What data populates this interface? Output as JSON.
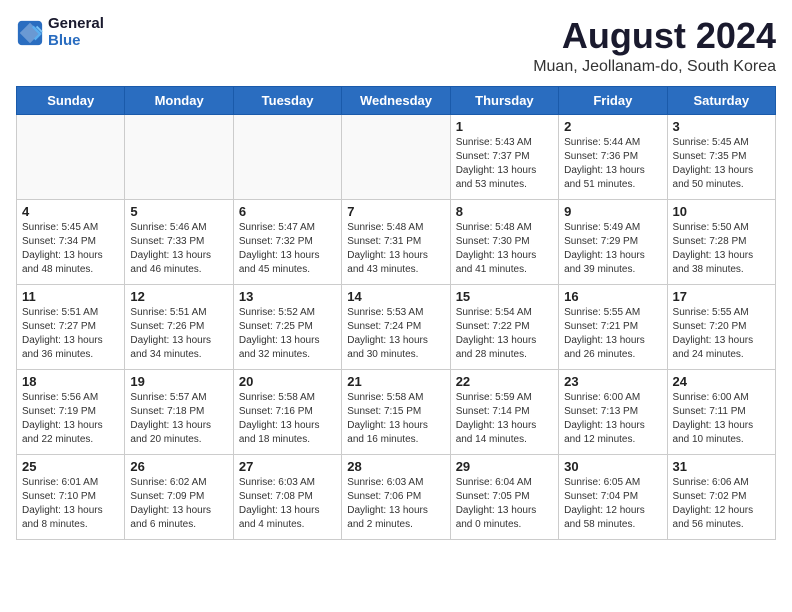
{
  "logo": {
    "line1": "General",
    "line2": "Blue"
  },
  "title": "August 2024",
  "subtitle": "Muan, Jeollanam-do, South Korea",
  "weekdays": [
    "Sunday",
    "Monday",
    "Tuesday",
    "Wednesday",
    "Thursday",
    "Friday",
    "Saturday"
  ],
  "weeks": [
    [
      {
        "day": "",
        "info": ""
      },
      {
        "day": "",
        "info": ""
      },
      {
        "day": "",
        "info": ""
      },
      {
        "day": "",
        "info": ""
      },
      {
        "day": "1",
        "info": "Sunrise: 5:43 AM\nSunset: 7:37 PM\nDaylight: 13 hours\nand 53 minutes."
      },
      {
        "day": "2",
        "info": "Sunrise: 5:44 AM\nSunset: 7:36 PM\nDaylight: 13 hours\nand 51 minutes."
      },
      {
        "day": "3",
        "info": "Sunrise: 5:45 AM\nSunset: 7:35 PM\nDaylight: 13 hours\nand 50 minutes."
      }
    ],
    [
      {
        "day": "4",
        "info": "Sunrise: 5:45 AM\nSunset: 7:34 PM\nDaylight: 13 hours\nand 48 minutes."
      },
      {
        "day": "5",
        "info": "Sunrise: 5:46 AM\nSunset: 7:33 PM\nDaylight: 13 hours\nand 46 minutes."
      },
      {
        "day": "6",
        "info": "Sunrise: 5:47 AM\nSunset: 7:32 PM\nDaylight: 13 hours\nand 45 minutes."
      },
      {
        "day": "7",
        "info": "Sunrise: 5:48 AM\nSunset: 7:31 PM\nDaylight: 13 hours\nand 43 minutes."
      },
      {
        "day": "8",
        "info": "Sunrise: 5:48 AM\nSunset: 7:30 PM\nDaylight: 13 hours\nand 41 minutes."
      },
      {
        "day": "9",
        "info": "Sunrise: 5:49 AM\nSunset: 7:29 PM\nDaylight: 13 hours\nand 39 minutes."
      },
      {
        "day": "10",
        "info": "Sunrise: 5:50 AM\nSunset: 7:28 PM\nDaylight: 13 hours\nand 38 minutes."
      }
    ],
    [
      {
        "day": "11",
        "info": "Sunrise: 5:51 AM\nSunset: 7:27 PM\nDaylight: 13 hours\nand 36 minutes."
      },
      {
        "day": "12",
        "info": "Sunrise: 5:51 AM\nSunset: 7:26 PM\nDaylight: 13 hours\nand 34 minutes."
      },
      {
        "day": "13",
        "info": "Sunrise: 5:52 AM\nSunset: 7:25 PM\nDaylight: 13 hours\nand 32 minutes."
      },
      {
        "day": "14",
        "info": "Sunrise: 5:53 AM\nSunset: 7:24 PM\nDaylight: 13 hours\nand 30 minutes."
      },
      {
        "day": "15",
        "info": "Sunrise: 5:54 AM\nSunset: 7:22 PM\nDaylight: 13 hours\nand 28 minutes."
      },
      {
        "day": "16",
        "info": "Sunrise: 5:55 AM\nSunset: 7:21 PM\nDaylight: 13 hours\nand 26 minutes."
      },
      {
        "day": "17",
        "info": "Sunrise: 5:55 AM\nSunset: 7:20 PM\nDaylight: 13 hours\nand 24 minutes."
      }
    ],
    [
      {
        "day": "18",
        "info": "Sunrise: 5:56 AM\nSunset: 7:19 PM\nDaylight: 13 hours\nand 22 minutes."
      },
      {
        "day": "19",
        "info": "Sunrise: 5:57 AM\nSunset: 7:18 PM\nDaylight: 13 hours\nand 20 minutes."
      },
      {
        "day": "20",
        "info": "Sunrise: 5:58 AM\nSunset: 7:16 PM\nDaylight: 13 hours\nand 18 minutes."
      },
      {
        "day": "21",
        "info": "Sunrise: 5:58 AM\nSunset: 7:15 PM\nDaylight: 13 hours\nand 16 minutes."
      },
      {
        "day": "22",
        "info": "Sunrise: 5:59 AM\nSunset: 7:14 PM\nDaylight: 13 hours\nand 14 minutes."
      },
      {
        "day": "23",
        "info": "Sunrise: 6:00 AM\nSunset: 7:13 PM\nDaylight: 13 hours\nand 12 minutes."
      },
      {
        "day": "24",
        "info": "Sunrise: 6:00 AM\nSunset: 7:11 PM\nDaylight: 13 hours\nand 10 minutes."
      }
    ],
    [
      {
        "day": "25",
        "info": "Sunrise: 6:01 AM\nSunset: 7:10 PM\nDaylight: 13 hours\nand 8 minutes."
      },
      {
        "day": "26",
        "info": "Sunrise: 6:02 AM\nSunset: 7:09 PM\nDaylight: 13 hours\nand 6 minutes."
      },
      {
        "day": "27",
        "info": "Sunrise: 6:03 AM\nSunset: 7:08 PM\nDaylight: 13 hours\nand 4 minutes."
      },
      {
        "day": "28",
        "info": "Sunrise: 6:03 AM\nSunset: 7:06 PM\nDaylight: 13 hours\nand 2 minutes."
      },
      {
        "day": "29",
        "info": "Sunrise: 6:04 AM\nSunset: 7:05 PM\nDaylight: 13 hours\nand 0 minutes."
      },
      {
        "day": "30",
        "info": "Sunrise: 6:05 AM\nSunset: 7:04 PM\nDaylight: 12 hours\nand 58 minutes."
      },
      {
        "day": "31",
        "info": "Sunrise: 6:06 AM\nSunset: 7:02 PM\nDaylight: 12 hours\nand 56 minutes."
      }
    ]
  ]
}
